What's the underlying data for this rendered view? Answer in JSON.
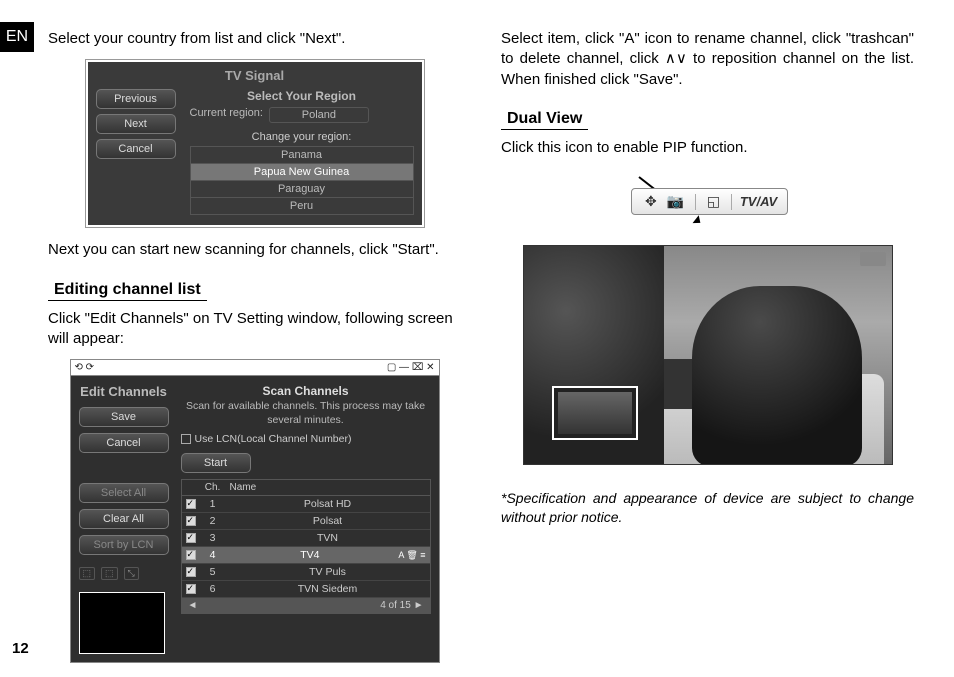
{
  "lang": "EN",
  "page_number": "12",
  "left": {
    "p1": "Select your country from list and click \"Next\".",
    "p2": "Next you can start new scanning for channels, click \"Start\".",
    "h1": "Editing channel list",
    "p3": "Click \"Edit Channels\" on TV Setting window, following screen will appear:"
  },
  "right": {
    "p1": "Select item, click \"A\" icon to rename channel, click \"trashcan\" to delete channel, click ∧∨ to reposition channel on the list. When finished click \"Save\".",
    "h1": "Dual View",
    "p2": "Click this icon to enable PIP function.",
    "footnote": "*Specification and appearance of device are subject to change without prior notice."
  },
  "tv_signal": {
    "title": "TV Signal",
    "btn_prev": "Previous",
    "btn_next": "Next",
    "btn_cancel": "Cancel",
    "label_select": "Select Your Region",
    "label_current": "Current region:",
    "current_value": "Poland",
    "label_change": "Change your region:",
    "regions": [
      "Panama",
      "Papua New Guinea",
      "Paraguay",
      "Peru"
    ]
  },
  "edit_channels": {
    "win_left": "⟲ ⟳",
    "win_right": "▢ — ⌧ ✕",
    "title": "Edit Channels",
    "btn_save": "Save",
    "btn_cancel": "Cancel",
    "btn_selectall": "Select All",
    "btn_clearall": "Clear All",
    "btn_sort": "Sort by LCN",
    "sub_title": "Scan Channels",
    "sub_desc": "Scan for available channels. This process may take several minutes.",
    "chk_lcn": "Use LCN(Local Channel Number)",
    "btn_start": "Start",
    "col_ch": "Ch.",
    "col_name": "Name",
    "rows": [
      {
        "ch": "1",
        "name": "Polsat HD"
      },
      {
        "ch": "2",
        "name": "Polsat"
      },
      {
        "ch": "3",
        "name": "TVN"
      },
      {
        "ch": "4",
        "name": "TV4"
      },
      {
        "ch": "5",
        "name": "TV Puls"
      },
      {
        "ch": "6",
        "name": "TVN Siedem"
      }
    ],
    "row_icons": "A 🗑 ≡",
    "pager_left": "◄",
    "pager_text": "4 of 15",
    "pager_right": "►",
    "ctrl1": "⬚",
    "ctrl2": "⬚",
    "ctrl3": "⤡"
  },
  "toolbar": {
    "move": "✥",
    "camera": "📷",
    "pip": "◱",
    "tv": "TV/AV"
  }
}
